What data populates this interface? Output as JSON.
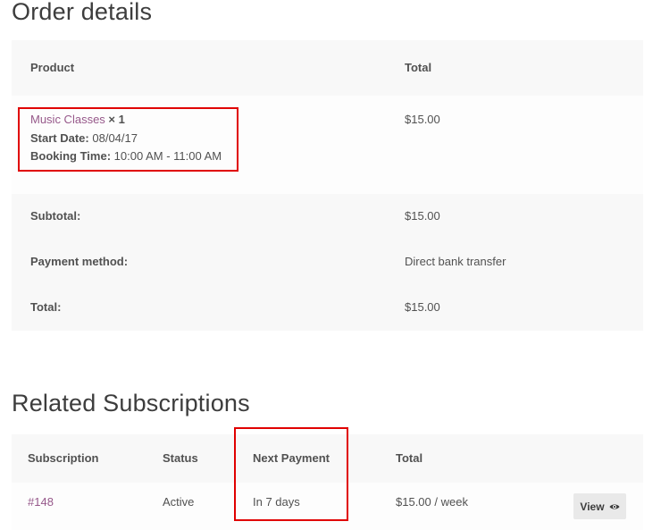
{
  "order": {
    "title": "Order details",
    "header": {
      "product": "Product",
      "total": "Total"
    },
    "item": {
      "name": "Music Classes",
      "qty": "× 1",
      "start_label": "Start Date:",
      "start_value": "08/04/17",
      "booking_label": "Booking Time:",
      "booking_value": "10:00 AM - 11:00 AM",
      "total": "$15.00"
    },
    "totals": [
      {
        "label": "Subtotal:",
        "value": "$15.00"
      },
      {
        "label": "Payment method:",
        "value": "Direct bank transfer"
      },
      {
        "label": "Total:",
        "value": "$15.00"
      }
    ]
  },
  "subscriptions": {
    "title": "Related Subscriptions",
    "header": {
      "subscription": "Subscription",
      "status": "Status",
      "next_payment": "Next Payment",
      "total": "Total"
    },
    "rows": [
      {
        "id": "#148",
        "status": "Active",
        "next_payment": "In 7 days",
        "total": "$15.00 / week",
        "action": "View"
      }
    ]
  },
  "colors": {
    "link": "#96588a",
    "highlight": "#e00000",
    "row_shade": "#f8f8f8"
  },
  "icons": {
    "view": "eye-icon"
  }
}
